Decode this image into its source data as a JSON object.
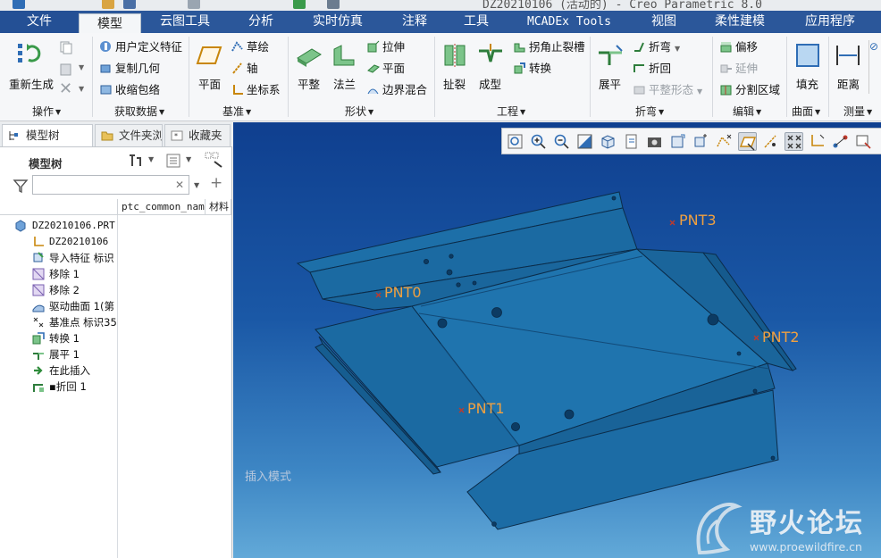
{
  "window": {
    "title": "DZ20210106 (活动的) - Creo Parametric 8.0"
  },
  "tabs": [
    {
      "label": "文件"
    },
    {
      "label": "模型"
    },
    {
      "label": "云图工具"
    },
    {
      "label": "分析"
    },
    {
      "label": "实时仿真"
    },
    {
      "label": "注释"
    },
    {
      "label": "工具"
    },
    {
      "label": "MCADEx Tools"
    },
    {
      "label": "视图"
    },
    {
      "label": "柔性建模"
    },
    {
      "label": "应用程序"
    }
  ],
  "ribbon": {
    "groups": [
      {
        "label": "操作"
      },
      {
        "label": "获取数据"
      },
      {
        "label": "基准"
      },
      {
        "label": "形状"
      },
      {
        "label": "工程"
      },
      {
        "label": "折弯"
      },
      {
        "label": "编辑"
      },
      {
        "label": "曲面"
      },
      {
        "label": "测量"
      }
    ],
    "regenerate": "重新生成",
    "user_defined_feature": "用户定义特征",
    "copy_geometry": "复制几何",
    "shrinkwrap": "收缩包络",
    "plane": "平面",
    "sketch": "草绘",
    "axis": "轴",
    "coordinate_system": "坐标系",
    "planar": "平整",
    "flange": "法兰",
    "extrude": "拉伸",
    "flat": "平面",
    "boundary_blend": "边界混合",
    "rip": "扯裂",
    "form": "成型",
    "corner_relief": "拐角止裂槽",
    "convert": "转换",
    "unbend": "展平",
    "bend": "折弯",
    "bend_back": "折回",
    "flat_pattern": "平整形态",
    "offset": "偏移",
    "extend": "延伸",
    "split_area": "分割区域",
    "fill": "填充",
    "distance": "距离"
  },
  "panel": {
    "tabs": [
      {
        "label": "模型树"
      },
      {
        "label": "文件夹浏览器"
      },
      {
        "label": "收藏夹"
      }
    ],
    "tree_title": "模型树",
    "filter_value": "",
    "columns": [
      {
        "label": "ptc_common_name"
      },
      {
        "label": "材料"
      }
    ],
    "tree": [
      {
        "text": "DZ20210106.PRT",
        "icon": "part-icon"
      },
      {
        "text": "DZ20210106",
        "icon": "csys-icon"
      },
      {
        "text": "导入特征 标识",
        "icon": "import-icon"
      },
      {
        "text": "移除 1",
        "icon": "remove-icon"
      },
      {
        "text": "移除 2",
        "icon": "remove-icon"
      },
      {
        "text": "驱动曲面 1(第",
        "icon": "driving-surface-icon"
      },
      {
        "text": "基准点 标识35",
        "icon": "datum-point-icon"
      },
      {
        "text": "转换 1",
        "icon": "convert-icon"
      },
      {
        "text": "展平 1",
        "icon": "unbend-icon"
      },
      {
        "text": "在此插入",
        "icon": "insert-arrow-icon"
      },
      {
        "text": "▪折回 1",
        "icon": "bend-back-icon"
      }
    ]
  },
  "viewport": {
    "mode_text": "插入模式",
    "points": [
      {
        "label": "PNT0"
      },
      {
        "label": "PNT1"
      },
      {
        "label": "PNT2"
      },
      {
        "label": "PNT3"
      }
    ],
    "watermark_text": "野火论坛",
    "watermark_url": "www.proewildfire.cn"
  }
}
